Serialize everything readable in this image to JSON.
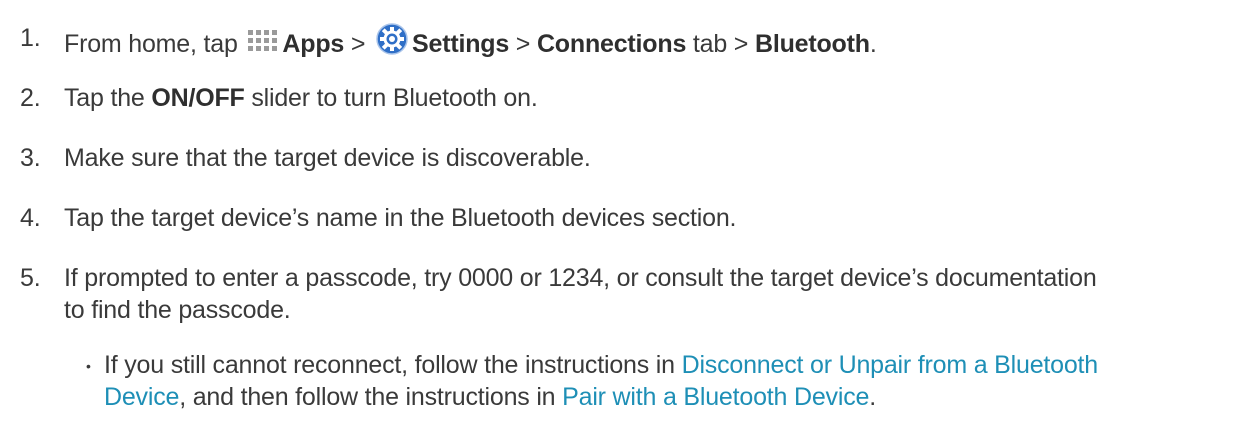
{
  "steps": [
    {
      "number": "1.",
      "from_home_tap": "From home, tap",
      "apps": "Apps",
      "sep1": ">",
      "settings": "Settings",
      "sep2": ">",
      "connections": "Connections",
      "tab_sep": "tab >",
      "bluetooth": "Bluetooth",
      "period": ".",
      "apps_icon": "apps-grid-icon",
      "settings_icon": "settings-gear-icon"
    },
    {
      "number": "2.",
      "prefix": "Tap the",
      "bold": "ON/OFF",
      "suffix": "slider to turn Bluetooth on."
    },
    {
      "number": "3.",
      "text": "Make sure that the target device is discoverable."
    },
    {
      "number": "4.",
      "text": "Tap the target device’s name in the Bluetooth devices section."
    },
    {
      "number": "5.",
      "line1": "If prompted to enter a passcode, try 0000 or 1234, or consult the target device’s documentation",
      "line2": "to find the passcode."
    }
  ],
  "bullet": {
    "symbol": "•",
    "prefix": "If you still cannot reconnect, follow the instructions in",
    "link1_line1": "Disconnect or Unpair from a Bluetooth",
    "link1_line2": "Device",
    "middle": ", and then follow the instructions in",
    "link2": "Pair with a Bluetooth Device",
    "end": "."
  },
  "colors": {
    "text": "#3a3a3a",
    "link": "#1e8fb6",
    "settings_icon": "#2f6fc7"
  }
}
